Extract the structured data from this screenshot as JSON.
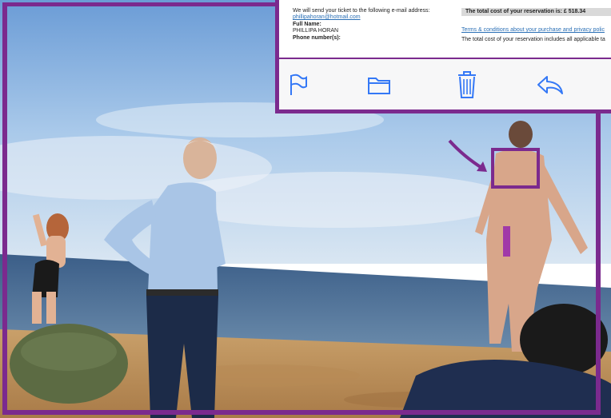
{
  "email": {
    "send_line": "We will send your ticket to the following e-mail address:",
    "email_address": "phillipahoran@hotmail.com",
    "full_name_label": "Full Name:",
    "full_name_value": "PHILLIPA HORAN",
    "phone_label": "Phone number(s):",
    "total_cost": "The total cost of your reservation is:   £ 518.34",
    "terms_link": "Terms & conditions about your purchase and privacy polic",
    "includes_line": "The total cost of your reservation includes all applicable ta"
  },
  "toolbar": {
    "icons": [
      "flag-icon",
      "folder-icon",
      "trash-icon",
      "reply-icon"
    ]
  },
  "colors": {
    "frame": "#7b2a8e",
    "link": "#2a6fb5",
    "toolbar_icon": "#3478f6"
  }
}
